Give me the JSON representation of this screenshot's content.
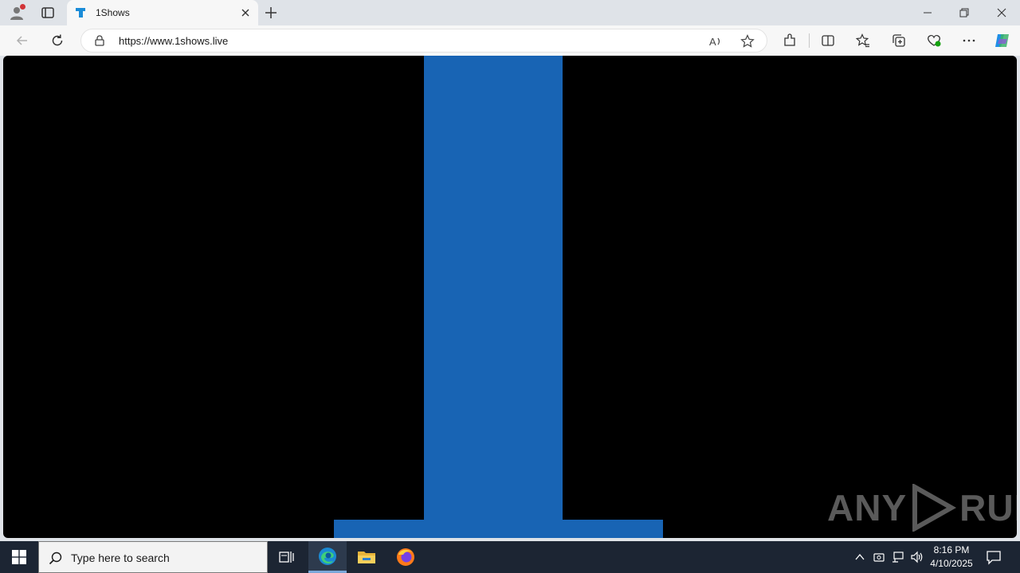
{
  "browser": {
    "tab": {
      "title": "1Shows"
    },
    "address": {
      "url": "https://www.1shows.live"
    }
  },
  "content": {
    "background": "#000000",
    "logo_color": "#1864b4",
    "watermark": {
      "left": "ANY",
      "right": "RUN"
    }
  },
  "taskbar": {
    "search_placeholder": "Type here to search",
    "time": "8:16 PM",
    "date": "4/10/2025"
  },
  "icons": [
    "profile-icon",
    "tab-actions-icon",
    "tab-favicon-icon",
    "close-tab-icon",
    "new-tab-icon",
    "minimize-icon",
    "restore-icon",
    "close-window-icon",
    "back-icon",
    "refresh-icon",
    "lock-icon",
    "read-aloud-icon",
    "favorite-star-icon",
    "extensions-icon",
    "split-screen-icon",
    "favorites-icon",
    "collections-icon",
    "browser-essentials-icon",
    "more-icon",
    "copilot-icon",
    "windows-start-icon",
    "search-icon",
    "task-view-icon",
    "edge-icon",
    "file-explorer-icon",
    "firefox-icon",
    "chevron-up-icon",
    "meet-now-icon",
    "network-icon",
    "volume-icon",
    "notifications-icon"
  ]
}
